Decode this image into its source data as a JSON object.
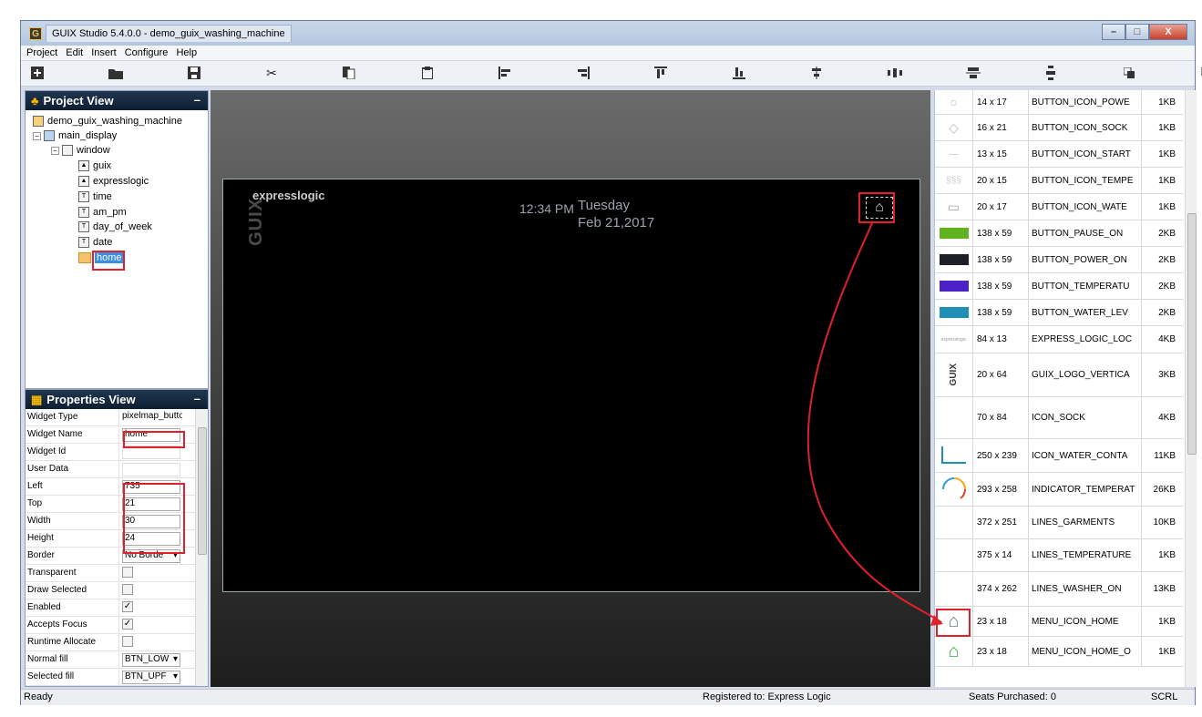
{
  "window": {
    "title": "GUIX Studio 5.4.0.0 - demo_guix_washing_machine",
    "minimize": "–",
    "maximize": "□",
    "close": "X"
  },
  "menu": [
    "Project",
    "Edit",
    "Insert",
    "Configure",
    "Help"
  ],
  "toolbar_icons": [
    "add-icon",
    "open-folder-icon",
    "save-icon",
    "cut-icon",
    "copy-icon",
    "paste-icon",
    "align-left-icon",
    "align-right-icon",
    "align-top-icon",
    "align-bottom-icon",
    "vcenter-icon",
    "hdistribute-icon",
    "hcenter-icon",
    "vdistribute-icon",
    "size-equal-icon",
    "size-fit-icon",
    "zoom-fit-icon",
    "zoom-out-icon",
    "zoom-in-icon"
  ],
  "project_view": {
    "title": "Project View",
    "min": "–",
    "nodes": [
      {
        "label": "demo_guix_washing_machine"
      },
      {
        "label": "main_display",
        "expander": "−"
      },
      {
        "label": "window",
        "expander": "−"
      },
      {
        "label": "guix"
      },
      {
        "label": "expresslogic"
      },
      {
        "label": "time"
      },
      {
        "label": "am_pm"
      },
      {
        "label": "day_of_week"
      },
      {
        "label": "date"
      },
      {
        "label": "home"
      }
    ]
  },
  "properties_view": {
    "title": "Properties View",
    "min": "–",
    "rows": [
      {
        "key": "Widget Type",
        "value": "pixelmap_butto"
      },
      {
        "key": "Widget Name",
        "value": "home"
      },
      {
        "key": "Widget Id",
        "value": ""
      },
      {
        "key": "User Data",
        "value": ""
      },
      {
        "key": "Left",
        "value": "735"
      },
      {
        "key": "Top",
        "value": "21"
      },
      {
        "key": "Width",
        "value": "30"
      },
      {
        "key": "Height",
        "value": "24"
      },
      {
        "key": "Border",
        "value": "No Borde"
      },
      {
        "key": "Transparent",
        "value": ""
      },
      {
        "key": "Draw Selected",
        "value": ""
      },
      {
        "key": "Enabled",
        "value": "✓"
      },
      {
        "key": "Accepts Focus",
        "value": "✓"
      },
      {
        "key": "Runtime Allocate",
        "value": ""
      },
      {
        "key": "Normal fill",
        "value": "BTN_LOW"
      },
      {
        "key": "Selected fill",
        "value": "BTN_UPF"
      }
    ]
  },
  "preview": {
    "logo": "expresslogic",
    "guix": "GUIX",
    "time": "12:34 PM",
    "day": "Tuesday",
    "date": "Feb 21,2017",
    "home_icon": "⌂"
  },
  "resources": [
    {
      "dim": "14 x 17",
      "name": "BUTTON_ICON_POWE",
      "size": "1KB",
      "preview": "○"
    },
    {
      "dim": "16 x 21",
      "name": "BUTTON_ICON_SOCK",
      "size": "1KB",
      "preview": "◇"
    },
    {
      "dim": "13 x 15",
      "name": "BUTTON_ICON_START",
      "size": "1KB",
      "preview": "—"
    },
    {
      "dim": "20 x 15",
      "name": "BUTTON_ICON_TEMPE",
      "size": "1KB",
      "preview": "§§§"
    },
    {
      "dim": "20 x 17",
      "name": "BUTTON_ICON_WATE",
      "size": "1KB",
      "preview": "▭"
    },
    {
      "dim": "138 x 59",
      "name": "BUTTON_PAUSE_ON",
      "size": "2KB",
      "preview": ""
    },
    {
      "dim": "138 x 59",
      "name": "BUTTON_POWER_ON",
      "size": "2KB",
      "preview": ""
    },
    {
      "dim": "138 x 59",
      "name": "BUTTON_TEMPERATU",
      "size": "2KB",
      "preview": ""
    },
    {
      "dim": "138 x 59",
      "name": "BUTTON_WATER_LEV",
      "size": "2KB",
      "preview": ""
    },
    {
      "dim": "84 x 13",
      "name": "EXPRESS_LOGIC_LOC",
      "size": "4KB",
      "preview": "expresslogic"
    },
    {
      "dim": "20 x 64",
      "name": "GUIX_LOGO_VERTICA",
      "size": "3KB",
      "preview": "GUIX"
    },
    {
      "dim": "70 x 84",
      "name": "ICON_SOCK",
      "size": "4KB",
      "preview": ""
    },
    {
      "dim": "250 x 239",
      "name": "ICON_WATER_CONTA",
      "size": "11KB",
      "preview": ""
    },
    {
      "dim": "293 x 258",
      "name": "INDICATOR_TEMPERAT",
      "size": "26KB",
      "preview": ""
    },
    {
      "dim": "372 x 251",
      "name": "LINES_GARMENTS",
      "size": "10KB",
      "preview": ""
    },
    {
      "dim": "375 x 14",
      "name": "LINES_TEMPERATURE",
      "size": "1KB",
      "preview": ""
    },
    {
      "dim": "374 x 262",
      "name": "LINES_WASHER_ON",
      "size": "13KB",
      "preview": ""
    },
    {
      "dim": "23 x 18",
      "name": "MENU_ICON_HOME",
      "size": "1KB",
      "preview": "⌂"
    },
    {
      "dim": "23 x 18",
      "name": "MENU_ICON_HOME_O",
      "size": "1KB",
      "preview": "⌂"
    }
  ],
  "colors": {
    "pause": "#5fb31e",
    "power": "#1f1f2a",
    "temperature": "#4a22c8",
    "water": "#1f8fb6",
    "highlight": "#e0202a",
    "panel_header": "#16283f"
  },
  "status": {
    "left": "Ready",
    "registered": "Registered to: Express Logic",
    "seats": "Seats Purchased: 0",
    "scrl": "SCRL"
  }
}
